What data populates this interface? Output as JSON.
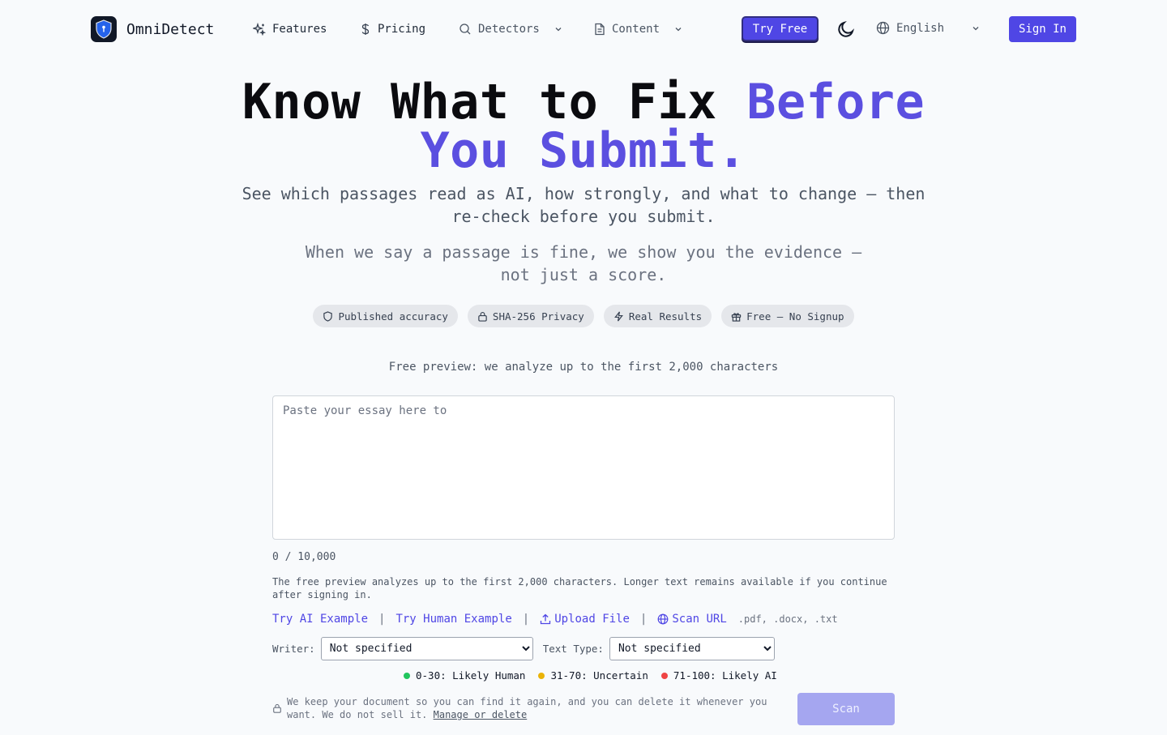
{
  "brand": {
    "name": "OmniDetect"
  },
  "nav": {
    "features": "Features",
    "pricing": "Pricing",
    "detectors": "Detectors",
    "content": "Content",
    "try_free": "Try Free",
    "language": "English",
    "sign_in": "Sign In"
  },
  "hero": {
    "title_main": "Know What to Fix ",
    "title_accent1": "Before",
    "title_accent2": "You Submit",
    "title_end": ".",
    "subtitle": "See which passages read as AI, how strongly, and what to change — then re-check before you submit.",
    "subtitle2": "When we say a passage is fine, we show you the evidence — not just a score."
  },
  "badges": [
    {
      "label": "Published accuracy",
      "icon": "shield-icon"
    },
    {
      "label": "SHA-256 Privacy",
      "icon": "lock-icon"
    },
    {
      "label": "Real Results",
      "icon": "bolt-icon"
    },
    {
      "label": "Free — No Signup",
      "icon": "gift-icon"
    }
  ],
  "preview_note": "Free preview: we analyze up to the first 2,000 characters",
  "editor": {
    "placeholder": "Paste your essay here to",
    "value": "",
    "counter": "0 / 10,000",
    "info": "The free preview analyzes up to the first 2,000 characters. Longer text remains available if you continue after signing in."
  },
  "actions": {
    "try_ai": "Try AI Example",
    "try_human": "Try Human Example",
    "upload": "Upload File",
    "scan_url": "Scan URL",
    "formats": ".pdf, .docx, .txt",
    "separator": "|"
  },
  "selectors": {
    "writer_label": "Writer:",
    "writer_value": "Not specified",
    "type_label": "Text Type:",
    "type_value": "Not specified"
  },
  "legend": [
    {
      "label": "0-30: Likely Human",
      "color": "#22c55e"
    },
    {
      "label": "31-70: Uncertain",
      "color": "#eab308"
    },
    {
      "label": "71-100: Likely AI",
      "color": "#ef4444"
    }
  ],
  "privacy": {
    "text": "We keep your document so you can find it again, and you can delete it whenever you want. We do not sell it. ",
    "link": "Manage or delete"
  },
  "scan": {
    "label": "Scan"
  },
  "colors": {
    "accent": "#4f46e5",
    "accent_text": "#5b4fe0",
    "scan_disabled": "#a5a6f0"
  }
}
